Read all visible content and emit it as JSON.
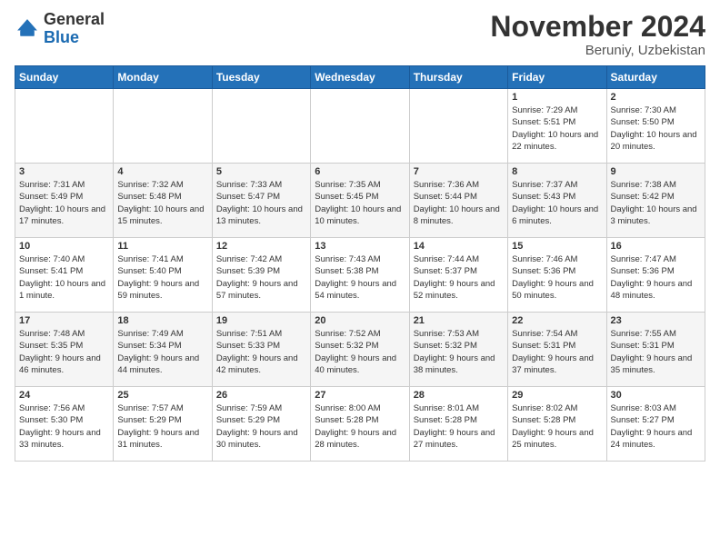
{
  "logo": {
    "general": "General",
    "blue": "Blue"
  },
  "header": {
    "month": "November 2024",
    "location": "Beruniy, Uzbekistan"
  },
  "weekdays": [
    "Sunday",
    "Monday",
    "Tuesday",
    "Wednesday",
    "Thursday",
    "Friday",
    "Saturday"
  ],
  "weeks": [
    [
      {
        "day": "",
        "info": ""
      },
      {
        "day": "",
        "info": ""
      },
      {
        "day": "",
        "info": ""
      },
      {
        "day": "",
        "info": ""
      },
      {
        "day": "",
        "info": ""
      },
      {
        "day": "1",
        "info": "Sunrise: 7:29 AM\nSunset: 5:51 PM\nDaylight: 10 hours and 22 minutes."
      },
      {
        "day": "2",
        "info": "Sunrise: 7:30 AM\nSunset: 5:50 PM\nDaylight: 10 hours and 20 minutes."
      }
    ],
    [
      {
        "day": "3",
        "info": "Sunrise: 7:31 AM\nSunset: 5:49 PM\nDaylight: 10 hours and 17 minutes."
      },
      {
        "day": "4",
        "info": "Sunrise: 7:32 AM\nSunset: 5:48 PM\nDaylight: 10 hours and 15 minutes."
      },
      {
        "day": "5",
        "info": "Sunrise: 7:33 AM\nSunset: 5:47 PM\nDaylight: 10 hours and 13 minutes."
      },
      {
        "day": "6",
        "info": "Sunrise: 7:35 AM\nSunset: 5:45 PM\nDaylight: 10 hours and 10 minutes."
      },
      {
        "day": "7",
        "info": "Sunrise: 7:36 AM\nSunset: 5:44 PM\nDaylight: 10 hours and 8 minutes."
      },
      {
        "day": "8",
        "info": "Sunrise: 7:37 AM\nSunset: 5:43 PM\nDaylight: 10 hours and 6 minutes."
      },
      {
        "day": "9",
        "info": "Sunrise: 7:38 AM\nSunset: 5:42 PM\nDaylight: 10 hours and 3 minutes."
      }
    ],
    [
      {
        "day": "10",
        "info": "Sunrise: 7:40 AM\nSunset: 5:41 PM\nDaylight: 10 hours and 1 minute."
      },
      {
        "day": "11",
        "info": "Sunrise: 7:41 AM\nSunset: 5:40 PM\nDaylight: 9 hours and 59 minutes."
      },
      {
        "day": "12",
        "info": "Sunrise: 7:42 AM\nSunset: 5:39 PM\nDaylight: 9 hours and 57 minutes."
      },
      {
        "day": "13",
        "info": "Sunrise: 7:43 AM\nSunset: 5:38 PM\nDaylight: 9 hours and 54 minutes."
      },
      {
        "day": "14",
        "info": "Sunrise: 7:44 AM\nSunset: 5:37 PM\nDaylight: 9 hours and 52 minutes."
      },
      {
        "day": "15",
        "info": "Sunrise: 7:46 AM\nSunset: 5:36 PM\nDaylight: 9 hours and 50 minutes."
      },
      {
        "day": "16",
        "info": "Sunrise: 7:47 AM\nSunset: 5:36 PM\nDaylight: 9 hours and 48 minutes."
      }
    ],
    [
      {
        "day": "17",
        "info": "Sunrise: 7:48 AM\nSunset: 5:35 PM\nDaylight: 9 hours and 46 minutes."
      },
      {
        "day": "18",
        "info": "Sunrise: 7:49 AM\nSunset: 5:34 PM\nDaylight: 9 hours and 44 minutes."
      },
      {
        "day": "19",
        "info": "Sunrise: 7:51 AM\nSunset: 5:33 PM\nDaylight: 9 hours and 42 minutes."
      },
      {
        "day": "20",
        "info": "Sunrise: 7:52 AM\nSunset: 5:32 PM\nDaylight: 9 hours and 40 minutes."
      },
      {
        "day": "21",
        "info": "Sunrise: 7:53 AM\nSunset: 5:32 PM\nDaylight: 9 hours and 38 minutes."
      },
      {
        "day": "22",
        "info": "Sunrise: 7:54 AM\nSunset: 5:31 PM\nDaylight: 9 hours and 37 minutes."
      },
      {
        "day": "23",
        "info": "Sunrise: 7:55 AM\nSunset: 5:31 PM\nDaylight: 9 hours and 35 minutes."
      }
    ],
    [
      {
        "day": "24",
        "info": "Sunrise: 7:56 AM\nSunset: 5:30 PM\nDaylight: 9 hours and 33 minutes."
      },
      {
        "day": "25",
        "info": "Sunrise: 7:57 AM\nSunset: 5:29 PM\nDaylight: 9 hours and 31 minutes."
      },
      {
        "day": "26",
        "info": "Sunrise: 7:59 AM\nSunset: 5:29 PM\nDaylight: 9 hours and 30 minutes."
      },
      {
        "day": "27",
        "info": "Sunrise: 8:00 AM\nSunset: 5:28 PM\nDaylight: 9 hours and 28 minutes."
      },
      {
        "day": "28",
        "info": "Sunrise: 8:01 AM\nSunset: 5:28 PM\nDaylight: 9 hours and 27 minutes."
      },
      {
        "day": "29",
        "info": "Sunrise: 8:02 AM\nSunset: 5:28 PM\nDaylight: 9 hours and 25 minutes."
      },
      {
        "day": "30",
        "info": "Sunrise: 8:03 AM\nSunset: 5:27 PM\nDaylight: 9 hours and 24 minutes."
      }
    ]
  ]
}
